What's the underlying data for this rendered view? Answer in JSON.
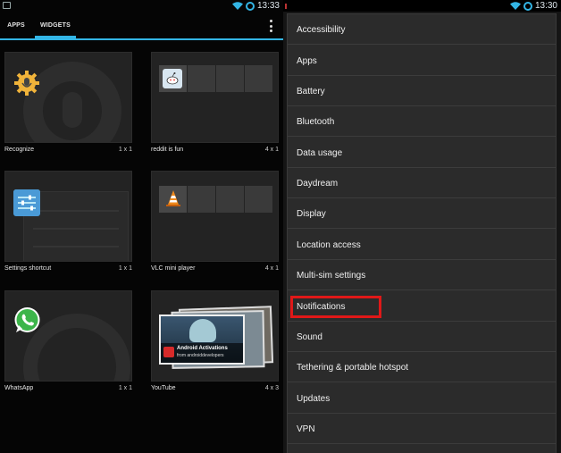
{
  "left_screen": {
    "status": {
      "time": "13:33"
    },
    "tabs": [
      {
        "label": "APPS"
      },
      {
        "label": "WIDGETS"
      }
    ],
    "widgets": [
      {
        "name": "Recognize",
        "size": "1 x 1",
        "icon": "gear-mic-icon"
      },
      {
        "name": "reddit is fun",
        "size": "4 x 1",
        "icon": "reddit-alien-icon"
      },
      {
        "name": "Settings shortcut",
        "size": "1 x 1",
        "icon": "settings-sliders-icon"
      },
      {
        "name": "VLC mini player",
        "size": "4 x 1",
        "icon": "vlc-cone-icon"
      },
      {
        "name": "WhatsApp",
        "size": "1 x 1",
        "icon": "whatsapp-icon"
      },
      {
        "name": "YouTube",
        "size": "4 x 3",
        "icon": "youtube-icon"
      }
    ],
    "youtube_preview": {
      "title": "Android Activations",
      "subtitle": "from androiddevelopers"
    }
  },
  "right_screen": {
    "status": {
      "time": "13:30"
    },
    "menu_items": [
      {
        "label": "Accessibility"
      },
      {
        "label": "Apps"
      },
      {
        "label": "Battery"
      },
      {
        "label": "Bluetooth"
      },
      {
        "label": "Data usage"
      },
      {
        "label": "Daydream"
      },
      {
        "label": "Display"
      },
      {
        "label": "Location access"
      },
      {
        "label": "Multi-sim settings"
      },
      {
        "label": "Notifications"
      },
      {
        "label": "Sound"
      },
      {
        "label": "Tethering & portable hotspot"
      },
      {
        "label": "Updates"
      },
      {
        "label": "VPN"
      }
    ],
    "highlighted_item": "Notifications"
  },
  "colors": {
    "accent": "#33b5e5",
    "highlight": "#e01818"
  }
}
